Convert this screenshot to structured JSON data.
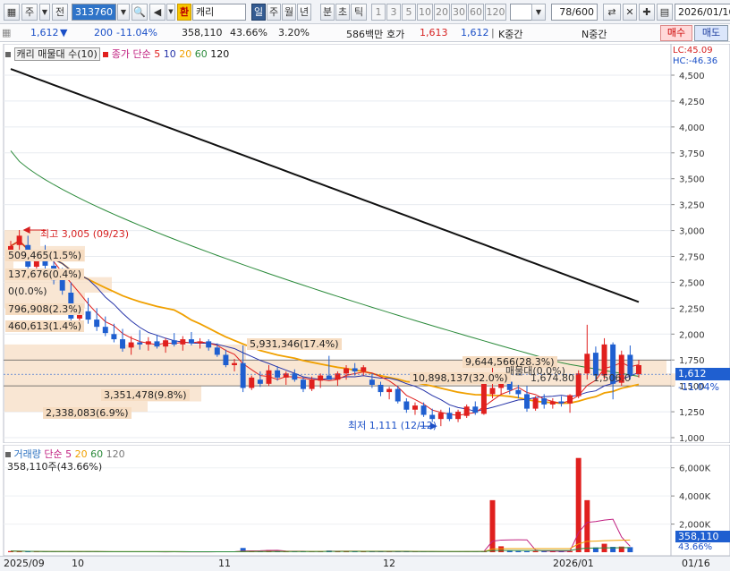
{
  "toolbar": {
    "market_type": "주",
    "market_scope": "전",
    "code": "313760",
    "fx_icon": "환",
    "stock_name": "캐리",
    "period_buttons": [
      "일",
      "주",
      "월",
      "년",
      "분",
      "초",
      "틱"
    ],
    "interval_buttons": [
      "1",
      "3",
      "5",
      "10",
      "20",
      "30",
      "60",
      "120"
    ],
    "count": "78/600",
    "date": "2026/01/16"
  },
  "quote": {
    "price": "1,612",
    "change": "200",
    "change_pct": "-11.04%",
    "volume": "358,110",
    "vol_ratio": "43.66%",
    "turnover_pct": "3.20%",
    "amount": "586백만",
    "bid_label": "호가",
    "ask": "1,613",
    "bid": "1,612",
    "k_label": "K중간",
    "n_label": "N중간",
    "buy_label": "매수",
    "sell_label": "매도"
  },
  "main_chart": {
    "title": "캐리 매물대 수(10)",
    "ma_label": "종가 단순",
    "ma_periods": [
      "5",
      "10",
      "20",
      "60",
      "120"
    ],
    "lc_label": "LC:45.09",
    "hc_label": "HC:-46.36",
    "current_price_tag": "1,612",
    "current_change_tag": "-11.04%",
    "high_annotation": "최고 3,005 (09/23)",
    "low_annotation": "최저 1,111 (12/12)",
    "profile_labels": [
      "509,465(1.5%)",
      "137,676(0.4%)",
      "0(0.0%)",
      "796,908(2.3%)",
      "460,613(1.4%)",
      "5,931,346(17.4%)",
      "9,644,566(28.3%)",
      "10,898,137(32.0%)",
      "3,351,478(9.8%)",
      "2,338,083(6.9%)",
      "매물대(0.0%)",
      "1,674.80",
      "1,506.0"
    ]
  },
  "volume_chart": {
    "title": "거래량",
    "ma_label": "단순",
    "ma_periods": [
      "5",
      "20",
      "60",
      "120"
    ],
    "current_label": "358,110주(43.66%)",
    "current_tag": "358,110",
    "current_pct_tag": "43.66%"
  },
  "colors": {
    "up": "#e0201e",
    "down": "#1f5fd0",
    "ma5": "#e0201e",
    "ma10": "#2432a8",
    "ma20": "#f0a000",
    "ma60": "#2a8a3a",
    "ma120": "#111111",
    "profile": "#f6dcc1"
  },
  "chart_data": {
    "type": "candlestick",
    "title": "캐리 매물대 수(10)",
    "y_range": [
      1000,
      4600
    ],
    "y_ticks": [
      "4,500",
      "4,250",
      "4,000",
      "3,750",
      "3,500",
      "3,250",
      "3,000",
      "2,750",
      "2,500",
      "2,250",
      "2,000",
      "1,750",
      "1,500",
      "1,250",
      "1,000"
    ],
    "x_labels": [
      "2025/09",
      "10",
      "11",
      "12",
      "2026/01",
      "01/16"
    ],
    "volume_ticks": [
      "6,000K",
      "4,000K",
      "2,000K"
    ],
    "candles": [
      {
        "o": 2800,
        "h": 2900,
        "l": 2720,
        "c": 2850
      },
      {
        "o": 2860,
        "h": 3005,
        "l": 2780,
        "c": 2950
      },
      {
        "o": 2860,
        "h": 2950,
        "l": 2600,
        "c": 2650
      },
      {
        "o": 2650,
        "h": 2780,
        "l": 2560,
        "c": 2720
      },
      {
        "o": 2720,
        "h": 2860,
        "l": 2620,
        "c": 2660
      },
      {
        "o": 2660,
        "h": 2720,
        "l": 2480,
        "c": 2520
      },
      {
        "o": 2530,
        "h": 2640,
        "l": 2380,
        "c": 2420
      },
      {
        "o": 2400,
        "h": 2500,
        "l": 2120,
        "c": 2150
      },
      {
        "o": 2150,
        "h": 2290,
        "l": 2080,
        "c": 2230
      },
      {
        "o": 2220,
        "h": 2350,
        "l": 2100,
        "c": 2140
      },
      {
        "o": 2140,
        "h": 2250,
        "l": 2030,
        "c": 2070
      },
      {
        "o": 2070,
        "h": 2170,
        "l": 1980,
        "c": 2010
      },
      {
        "o": 2000,
        "h": 2100,
        "l": 1920,
        "c": 1950
      },
      {
        "o": 1950,
        "h": 2050,
        "l": 1830,
        "c": 1860
      },
      {
        "o": 1870,
        "h": 1980,
        "l": 1800,
        "c": 1920
      },
      {
        "o": 1920,
        "h": 2040,
        "l": 1850,
        "c": 1900
      },
      {
        "o": 1900,
        "h": 1970,
        "l": 1840,
        "c": 1930
      },
      {
        "o": 1930,
        "h": 1990,
        "l": 1860,
        "c": 1880
      },
      {
        "o": 1880,
        "h": 1960,
        "l": 1820,
        "c": 1940
      },
      {
        "o": 1940,
        "h": 2010,
        "l": 1880,
        "c": 1900
      },
      {
        "o": 1900,
        "h": 1980,
        "l": 1840,
        "c": 1950
      },
      {
        "o": 1950,
        "h": 2020,
        "l": 1890,
        "c": 1910
      },
      {
        "o": 1910,
        "h": 1960,
        "l": 1860,
        "c": 1930
      },
      {
        "o": 1930,
        "h": 1950,
        "l": 1840,
        "c": 1870
      },
      {
        "o": 1870,
        "h": 1910,
        "l": 1780,
        "c": 1800
      },
      {
        "o": 1800,
        "h": 1850,
        "l": 1680,
        "c": 1700
      },
      {
        "o": 1700,
        "h": 1760,
        "l": 1640,
        "c": 1720
      },
      {
        "o": 1720,
        "h": 1890,
        "l": 1440,
        "c": 1480
      },
      {
        "o": 1480,
        "h": 1600,
        "l": 1460,
        "c": 1580
      },
      {
        "o": 1560,
        "h": 1640,
        "l": 1490,
        "c": 1520
      },
      {
        "o": 1520,
        "h": 1700,
        "l": 1500,
        "c": 1650
      },
      {
        "o": 1650,
        "h": 1690,
        "l": 1550,
        "c": 1580
      },
      {
        "o": 1580,
        "h": 1640,
        "l": 1510,
        "c": 1620
      },
      {
        "o": 1620,
        "h": 1660,
        "l": 1540,
        "c": 1560
      },
      {
        "o": 1560,
        "h": 1590,
        "l": 1440,
        "c": 1470
      },
      {
        "o": 1470,
        "h": 1590,
        "l": 1450,
        "c": 1560
      },
      {
        "o": 1550,
        "h": 1620,
        "l": 1480,
        "c": 1600
      },
      {
        "o": 1600,
        "h": 1790,
        "l": 1560,
        "c": 1560
      },
      {
        "o": 1560,
        "h": 1640,
        "l": 1500,
        "c": 1620
      },
      {
        "o": 1620,
        "h": 1700,
        "l": 1560,
        "c": 1670
      },
      {
        "o": 1670,
        "h": 1720,
        "l": 1600,
        "c": 1640
      },
      {
        "o": 1640,
        "h": 1700,
        "l": 1600,
        "c": 1680
      },
      {
        "o": 1560,
        "h": 1620,
        "l": 1480,
        "c": 1510
      },
      {
        "o": 1510,
        "h": 1540,
        "l": 1400,
        "c": 1440
      },
      {
        "o": 1440,
        "h": 1490,
        "l": 1370,
        "c": 1470
      },
      {
        "o": 1470,
        "h": 1500,
        "l": 1330,
        "c": 1350
      },
      {
        "o": 1350,
        "h": 1380,
        "l": 1240,
        "c": 1270
      },
      {
        "o": 1270,
        "h": 1340,
        "l": 1220,
        "c": 1310
      },
      {
        "o": 1310,
        "h": 1340,
        "l": 1200,
        "c": 1220
      },
      {
        "o": 1220,
        "h": 1280,
        "l": 1150,
        "c": 1180
      },
      {
        "o": 1180,
        "h": 1270,
        "l": 1111,
        "c": 1240
      },
      {
        "o": 1240,
        "h": 1290,
        "l": 1160,
        "c": 1180
      },
      {
        "o": 1180,
        "h": 1270,
        "l": 1150,
        "c": 1250
      },
      {
        "o": 1210,
        "h": 1320,
        "l": 1190,
        "c": 1300
      },
      {
        "o": 1300,
        "h": 1350,
        "l": 1220,
        "c": 1240
      },
      {
        "o": 1230,
        "h": 1550,
        "l": 1220,
        "c": 1530
      },
      {
        "o": 1420,
        "h": 1740,
        "l": 1380,
        "c": 1480
      },
      {
        "o": 1480,
        "h": 1580,
        "l": 1420,
        "c": 1540
      },
      {
        "o": 1540,
        "h": 1600,
        "l": 1420,
        "c": 1460
      },
      {
        "o": 1460,
        "h": 1510,
        "l": 1380,
        "c": 1420
      },
      {
        "o": 1420,
        "h": 1500,
        "l": 1250,
        "c": 1280
      },
      {
        "o": 1280,
        "h": 1400,
        "l": 1260,
        "c": 1380
      },
      {
        "o": 1380,
        "h": 1420,
        "l": 1280,
        "c": 1320
      },
      {
        "o": 1320,
        "h": 1380,
        "l": 1280,
        "c": 1350
      },
      {
        "o": 1350,
        "h": 1400,
        "l": 1300,
        "c": 1330
      },
      {
        "o": 1330,
        "h": 1420,
        "l": 1240,
        "c": 1410
      },
      {
        "o": 1400,
        "h": 1650,
        "l": 1380,
        "c": 1620
      },
      {
        "o": 1620,
        "h": 2090,
        "l": 1560,
        "c": 1810
      },
      {
        "o": 1820,
        "h": 1880,
        "l": 1560,
        "c": 1600
      },
      {
        "o": 1600,
        "h": 1960,
        "l": 1560,
        "c": 1900
      },
      {
        "o": 1900,
        "h": 1920,
        "l": 1370,
        "c": 1520
      },
      {
        "o": 1530,
        "h": 1840,
        "l": 1500,
        "c": 1800
      },
      {
        "o": 1800,
        "h": 1890,
        "l": 1560,
        "c": 1600
      },
      {
        "o": 1612,
        "h": 1750,
        "l": 1580,
        "c": 1700
      }
    ],
    "volume": [
      80,
      60,
      40,
      35,
      30,
      45,
      30,
      60,
      40,
      35,
      30,
      25,
      35,
      30,
      25,
      30,
      35,
      25,
      20,
      30,
      25,
      20,
      25,
      30,
      40,
      35,
      30,
      300,
      80,
      60,
      160,
      70,
      40,
      35,
      60,
      45,
      80,
      120,
      60,
      50,
      45,
      40,
      60,
      45,
      50,
      55,
      40,
      30,
      35,
      25,
      40,
      30,
      35,
      60,
      45,
      90,
      3700,
      420,
      120,
      80,
      70,
      80,
      60,
      55,
      70,
      80,
      6700,
      3700,
      340,
      600,
      380,
      400,
      358
    ]
  }
}
